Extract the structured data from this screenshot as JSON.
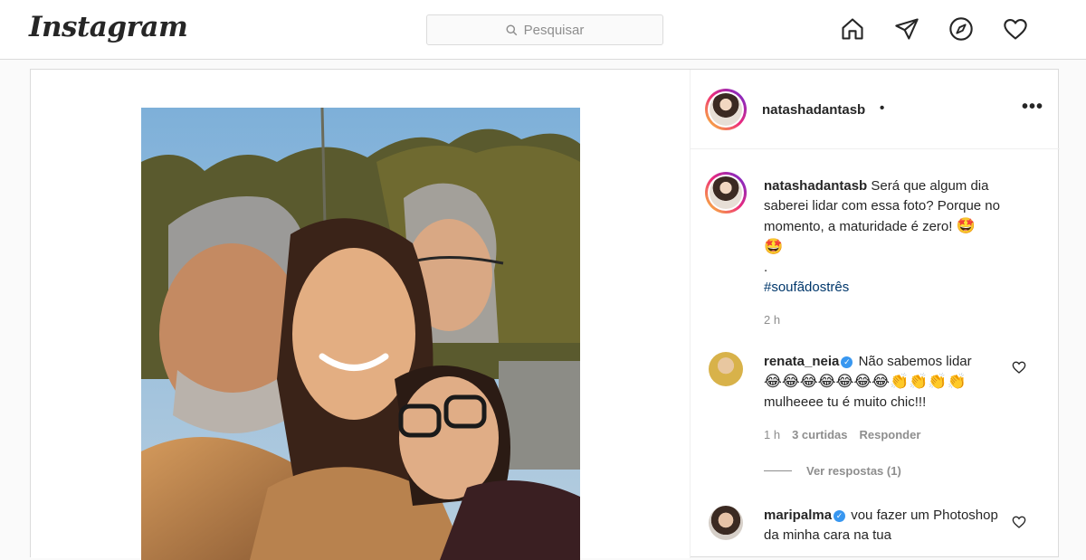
{
  "header": {
    "logo": "Instagram",
    "search_placeholder": "Pesquisar",
    "icons": [
      "home-icon",
      "direct-icon",
      "explore-icon",
      "activity-heart-icon"
    ]
  },
  "post": {
    "author": "natashadantasb",
    "separator": "•",
    "more": "•••",
    "caption": {
      "username": "natashadantasb",
      "text": "Será que algum dia saberei lidar com essa foto? Porque no momento, a maturidade é zero!",
      "emoji_inline": "🤩",
      "emoji_line": "🤩",
      "dot_line": ".",
      "hashtag": "#soufãdostrês",
      "time": "2 h"
    },
    "comments": [
      {
        "username": "renata_neia",
        "text": "Não sabemos lidar",
        "emojis": "😂😂😂😂😂😂😂👏👏👏👏",
        "text2": "mulheeee tu é muito chic!!!",
        "time": "1 h",
        "likes": "3 curtidas",
        "reply": "Responder",
        "view_replies": "Ver respostas (1)"
      },
      {
        "username": "maripalma",
        "text": "vou fazer um Photoshop da minha cara na tua"
      }
    ]
  },
  "colors": {
    "link": "#00376b",
    "muted": "#8e8e8e",
    "verified": "#3897f0",
    "border": "#dbdbdb"
  }
}
